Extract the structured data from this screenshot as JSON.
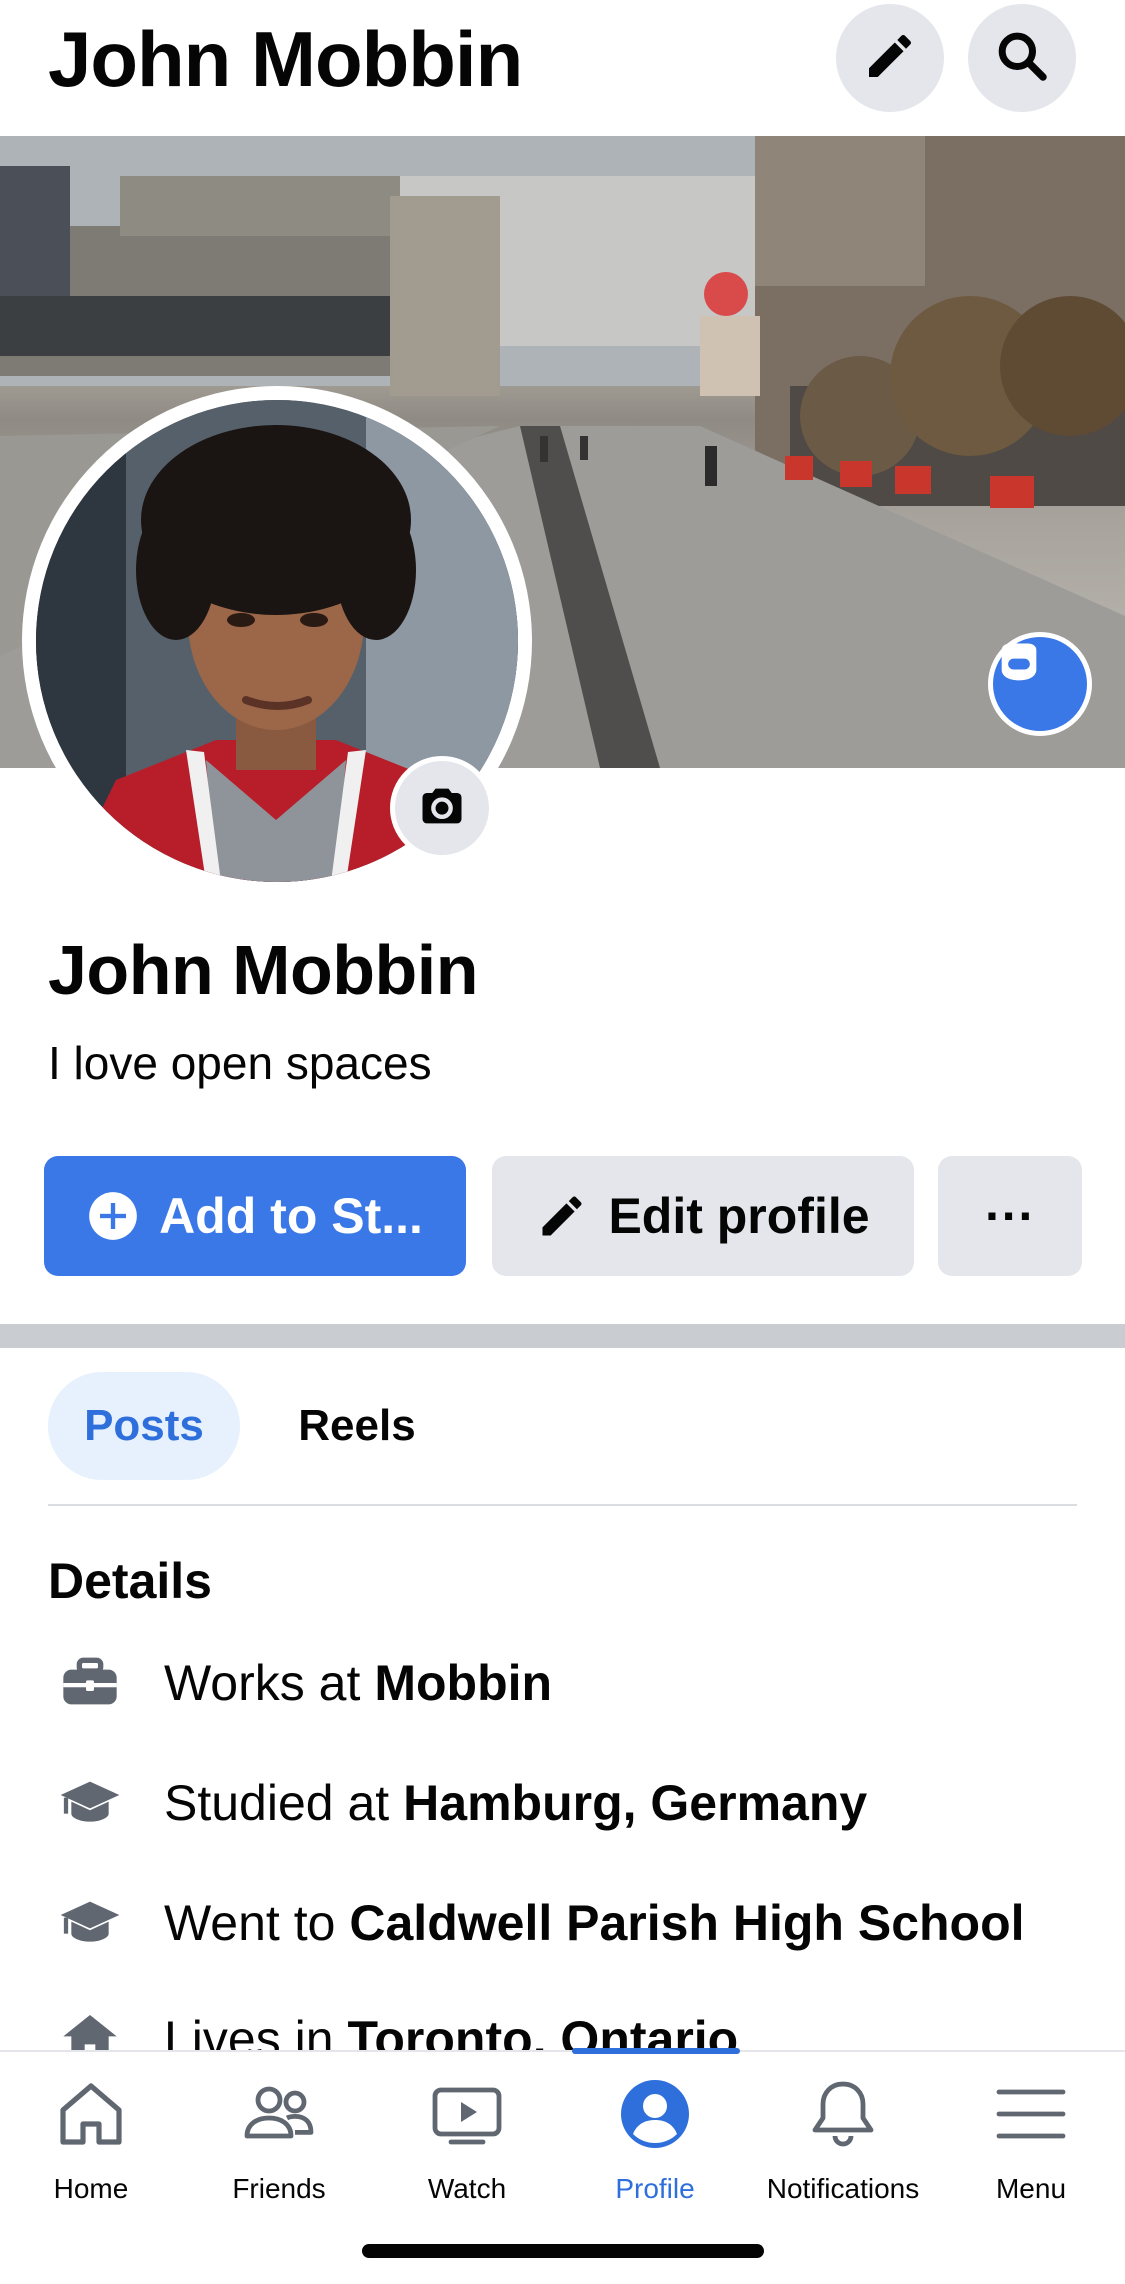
{
  "header": {
    "title": "John Mobbin",
    "edit_icon": "pencil-icon",
    "search_icon": "search-icon"
  },
  "profile": {
    "name": "John Mobbin",
    "bio": "I love open spaces"
  },
  "actions": {
    "add_label": "Add to St...",
    "edit_label": "Edit profile",
    "more_label": "···"
  },
  "tabs": [
    {
      "label": "Posts",
      "active": true
    },
    {
      "label": "Reels",
      "active": false
    }
  ],
  "details": {
    "title": "Details",
    "items": [
      {
        "icon": "briefcase-icon",
        "prefix": "Works at",
        "value": "Mobbin"
      },
      {
        "icon": "graduation-cap-icon",
        "prefix": "Studied at",
        "value": "Hamburg, Germany"
      },
      {
        "icon": "graduation-cap-icon",
        "prefix": "Went to",
        "value": "Caldwell Parish High School"
      },
      {
        "icon": "home-icon",
        "prefix": "Lives in",
        "value": "Toronto, Ontario"
      }
    ]
  },
  "nav": [
    {
      "label": "Home",
      "icon": "home-icon",
      "active": false
    },
    {
      "label": "Friends",
      "icon": "friends-icon",
      "active": false
    },
    {
      "label": "Watch",
      "icon": "watch-icon",
      "active": false
    },
    {
      "label": "Profile",
      "icon": "profile-icon",
      "active": true
    },
    {
      "label": "Notifications",
      "icon": "bell-icon",
      "active": false
    },
    {
      "label": "Menu",
      "icon": "menu-icon",
      "active": false
    }
  ],
  "colors": {
    "accent": "#3b78e7",
    "active_text": "#2f6fdc",
    "button_gray": "#e4e6eb",
    "tab_active_bg": "#e7f0fd"
  }
}
